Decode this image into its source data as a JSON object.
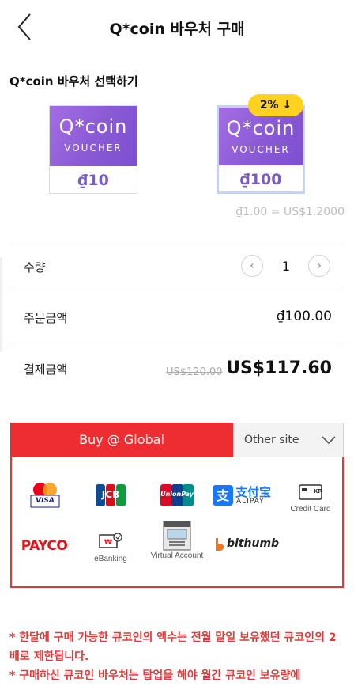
{
  "header": {
    "title": "Q*coin 바우처 구매",
    "back_icon": "chevron-left-icon"
  },
  "section": {
    "title": "Q*coin 바우처 선택하기"
  },
  "vouchers": [
    {
      "logo": "Q*coin",
      "subtitle": "VOUCHER",
      "amount": "₫10",
      "selected": false
    },
    {
      "logo": "Q*coin",
      "subtitle": "VOUCHER",
      "amount": "₫100",
      "selected": true,
      "badge": "2% ↓"
    }
  ],
  "rate": "₫1.00 = US$1.2000",
  "quantity": {
    "label": "수량",
    "value": "1",
    "minus_icon": "chevron-left-icon",
    "plus_icon": "chevron-right-icon"
  },
  "order": {
    "label": "주문금액",
    "value": "₫100.00"
  },
  "payment": {
    "label": "결제금액",
    "old_price": "US$120.00",
    "final_price": "US$117.60"
  },
  "tabs": {
    "global": "Buy @ Global",
    "other": "Other site"
  },
  "methods": {
    "mastercard_visa": "VISA",
    "jcb": "JCB",
    "unionpay": "UnionPay",
    "alipay_cn": "支付宝",
    "alipay_en": "ALIPAY",
    "credit_card": "Credit Card",
    "payco": "PAYCO",
    "ebanking": "eBanking",
    "virtual_account": "Virtual Account",
    "bithumb": "bithumb"
  },
  "notes": [
    "* 한달에 구매 가능한 큐코인의 액수는 전월 말일 보유했던 큐코인의 2배로 제한됩니다.",
    "* 구매하신 큐코인 바우처는 탑업을 해야 월간 큐코인 보유량에"
  ],
  "colors": {
    "accent": "#ee2d33",
    "voucher_purple": "#8b5bd6",
    "badge": "#ffd21f"
  }
}
